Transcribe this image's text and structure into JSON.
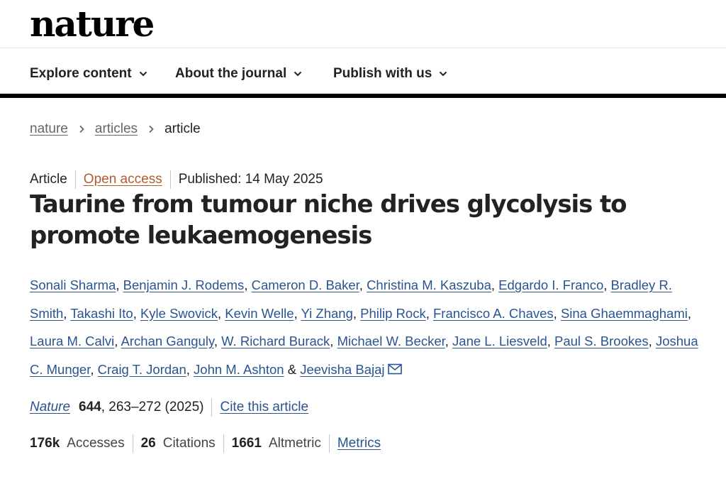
{
  "site": {
    "logo": "nature"
  },
  "nav": {
    "items": [
      {
        "label": "Explore content"
      },
      {
        "label": "About the journal"
      },
      {
        "label": "Publish with us"
      }
    ]
  },
  "breadcrumb": {
    "items": [
      "nature",
      "articles"
    ],
    "current": "article"
  },
  "article": {
    "type": "Article",
    "access": "Open access",
    "published": "Published: 14 May 2025",
    "title": "Taurine from tumour niche drives glycolysis to promote leukaemogenesis",
    "authors": [
      "Sonali Sharma",
      "Benjamin J. Rodems",
      "Cameron D. Baker",
      "Christina M. Kaszuba",
      "Edgardo I. Franco",
      "Bradley R. Smith",
      "Takashi Ito",
      "Kyle Swovick",
      "Kevin Welle",
      "Yi Zhang",
      "Philip Rock",
      "Francisco A. Chaves",
      "Sina Ghaemmaghami",
      "Laura M. Calvi",
      "Archan Ganguly",
      "W. Richard Burack",
      "Michael W. Becker",
      "Jane L. Liesveld",
      "Paul S. Brookes",
      "Joshua C. Munger",
      "Craig T. Jordan",
      "John M. Ashton",
      "Jeevisha Bajaj"
    ],
    "journal": "Nature",
    "volume": "644",
    "pages_year": ", 263–272 (2025)",
    "cite_label": "Cite this article"
  },
  "metrics": {
    "accesses_value": "176k",
    "accesses_label": "Accesses",
    "citations_value": "26",
    "citations_label": "Citations",
    "altmetric_value": "1661",
    "altmetric_label": "Altmetric",
    "metrics_link": "Metrics"
  },
  "icons": {
    "nav_chevron": "chevron-down-icon",
    "breadcrumb_sep": "chevron-right-icon",
    "corresponding": "mail-icon"
  },
  "colors": {
    "link": "#2a5490",
    "open_access": "#b15c2e",
    "text": "#222222",
    "muted": "#666666"
  }
}
